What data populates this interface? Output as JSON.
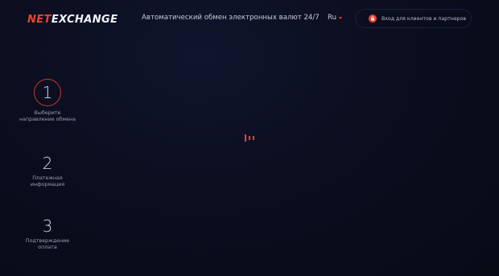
{
  "header": {
    "logo_prefix": "NET",
    "logo_main": "EXCHANGE",
    "tagline": "Автоматический обмен электронных валют 24/7",
    "language": "Ru",
    "login_label": "Вход для клиентов и партнеров"
  },
  "steps": [
    {
      "number": "1",
      "caption": "Выберите направление обмена",
      "active": true
    },
    {
      "number": "2",
      "caption": "Платежная информация",
      "active": false
    },
    {
      "number": "3",
      "caption": "Подтверждение оплата",
      "active": false
    }
  ],
  "colors": {
    "accent": "#e8452e",
    "background": "#0a0c1a",
    "text": "#c7cad8"
  },
  "icons": {
    "login": "lock-icon",
    "language": "caret-down-icon",
    "loader": "loading-bars-icon"
  }
}
